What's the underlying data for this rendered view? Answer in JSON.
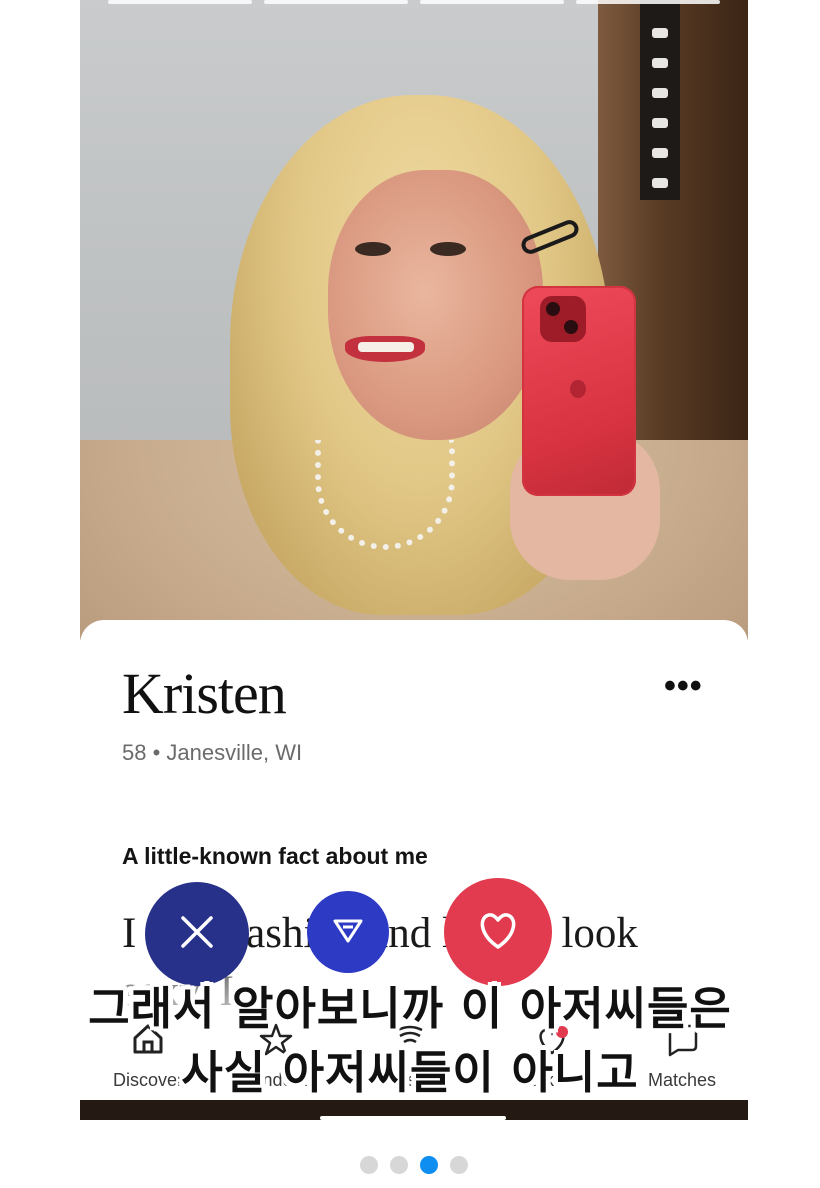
{
  "profile": {
    "name": "Kristen",
    "meta": "58 • Janesville, WI",
    "more_label": "•••",
    "prompt": {
      "title": "A little-known fact about me",
      "answer": "I love fashion and like to look sexy. I"
    }
  },
  "actions": {
    "skip_icon": "close-icon",
    "rose_icon": "send-icon",
    "like_icon": "heart-icon",
    "colors": {
      "skip": "#28318a",
      "rose": "#2c3ac4",
      "like": "#e23a4e"
    }
  },
  "nav": {
    "tabs": [
      {
        "label": "Discover",
        "icon": "home-icon"
      },
      {
        "label": "Standouts",
        "icon": "star-icon"
      },
      {
        "label": "Roses",
        "icon": "rose-icon"
      },
      {
        "label": "Likes",
        "icon": "heart-icon"
      },
      {
        "label": "Matches",
        "icon": "chat-icon"
      }
    ]
  },
  "caption": {
    "line1": "그래서 알아보니까 이 아저씨들은",
    "line2": "사실 아저씨들이 아니고"
  },
  "carousel": {
    "total": 4,
    "active": 3
  }
}
